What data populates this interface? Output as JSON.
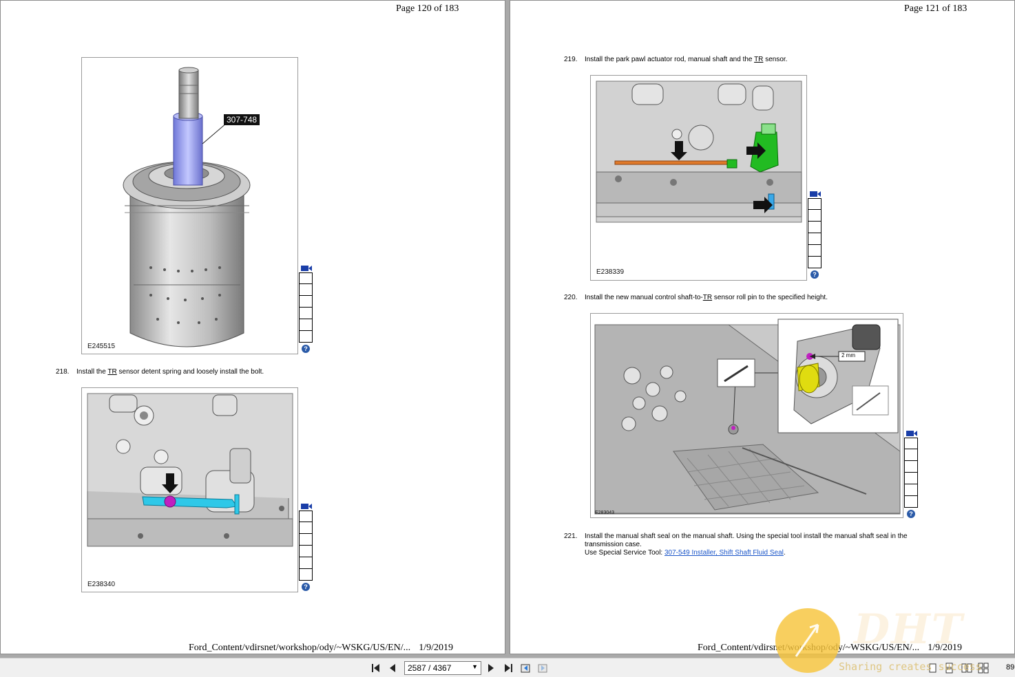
{
  "left_page": {
    "page_label": "Page 120 of 183",
    "figure_1": {
      "id": "E245515",
      "callout": "307-748"
    },
    "step_218": {
      "num": "218.",
      "text_pre": "Install the ",
      "abbr": "TR",
      "text_post": " sensor detent spring and loosely install the bolt."
    },
    "figure_2": {
      "id": "E238340"
    },
    "footer_path": "Ford_Content/vdirsnet/workshop/ody/~WSKG/US/EN/...",
    "footer_date": "1/9/2019"
  },
  "right_page": {
    "page_label": "Page 121 of 183",
    "step_219": {
      "num": "219.",
      "text_pre": "Install the park pawl actuator rod, manual shaft and the ",
      "abbr": "TR",
      "text_post": " sensor."
    },
    "figure_3": {
      "id": "E238339"
    },
    "step_220": {
      "num": "220.",
      "text_pre": "Install the new manual control shaft-to-",
      "abbr": "TR",
      "text_post": " sensor roll pin to the specified height."
    },
    "figure_4": {
      "id": "E283043",
      "dimension_label": "2 mm"
    },
    "step_221": {
      "num": "221.",
      "text_line1": "Install the manual shaft seal on the manual shaft. Using the special tool install the manual shaft seal in the",
      "text_line2": "transmission case.",
      "tool_prefix": "Use Special Service Tool: ",
      "tool_link": "307-549  Installer, Shift Shaft Fluid Seal",
      "tool_suffix": "."
    },
    "footer_path": "Ford_Content/vdirsnet/workshop/ody/~WSKG/US/EN/...",
    "footer_date": "1/9/2019"
  },
  "toolbar": {
    "page_field_value": "2587 / 4367",
    "zoom_text": "89",
    "icons": [
      "first-page-icon",
      "prev-page-icon",
      "next-page-icon",
      "last-page-icon",
      "go-back-icon",
      "go-forward-icon",
      "single-page-icon",
      "continuous-page-icon",
      "two-page-icon",
      "two-page-continuous-icon"
    ]
  },
  "watermark": {
    "brand": "DHT",
    "slogan": "Sharing creates success"
  },
  "colors": {
    "background": "#a9a9a9",
    "link": "#1a55c8",
    "help_icon": "#2a5aa8",
    "highlight_cyan": "#2ec8e8",
    "highlight_magenta": "#c020c0",
    "highlight_green": "#22bb22",
    "highlight_orange": "#e07a2a",
    "highlight_yellow": "#e0dc10",
    "tool_blue": "#9aa2f0"
  }
}
